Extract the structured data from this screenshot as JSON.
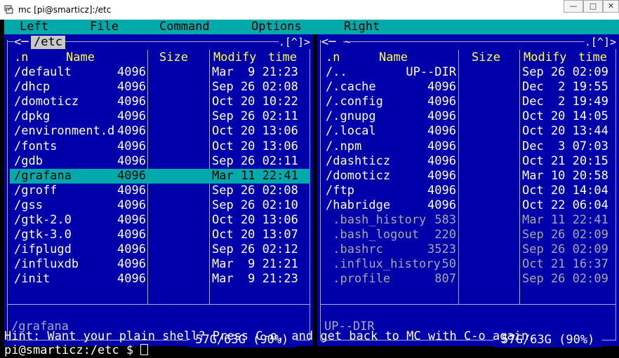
{
  "window": {
    "title": "mc [pi@smarticz]:/etc"
  },
  "menubar": {
    "items": [
      "Left",
      "File",
      "Command",
      "Options",
      "Right"
    ]
  },
  "left_panel": {
    "path": "/etc",
    "controls": ".[^]>",
    "columns": {
      "name_sort": ".n",
      "name": "Name",
      "size": "Size",
      "modify": "Modify",
      "time": "time"
    },
    "rows": [
      {
        "name": "/default",
        "size": "4096",
        "date": "Mar  9 21:23"
      },
      {
        "name": "/dhcp",
        "size": "4096",
        "date": "Sep 26 02:08"
      },
      {
        "name": "/domoticz",
        "size": "4096",
        "date": "Oct 20 10:22"
      },
      {
        "name": "/dpkg",
        "size": "4096",
        "date": "Sep 26 02:11"
      },
      {
        "name": "/environment.d",
        "size": "4096",
        "date": "Oct 20 13:06"
      },
      {
        "name": "/fonts",
        "size": "4096",
        "date": "Oct 20 13:06"
      },
      {
        "name": "/gdb",
        "size": "4096",
        "date": "Sep 26 02:11"
      },
      {
        "name": "/grafana",
        "size": "4096",
        "date": "Mar 11 22:41"
      },
      {
        "name": "/groff",
        "size": "4096",
        "date": "Sep 26 02:08"
      },
      {
        "name": "/gss",
        "size": "4096",
        "date": "Sep 26 02:10"
      },
      {
        "name": "/gtk-2.0",
        "size": "4096",
        "date": "Oct 20 13:06"
      },
      {
        "name": "/gtk-3.0",
        "size": "4096",
        "date": "Oct 20 13:07"
      },
      {
        "name": "/ifplugd",
        "size": "4096",
        "date": "Sep 26 02:12"
      },
      {
        "name": "/influxdb",
        "size": "4096",
        "date": "Mar  9 21:21"
      },
      {
        "name": "/init",
        "size": "4096",
        "date": "Mar  9 21:23"
      }
    ],
    "selected_index": 7,
    "status": "/grafana",
    "disk": " 57G/63G (90%) "
  },
  "right_panel": {
    "path": "~",
    "controls": ".[^]>",
    "columns": {
      "name_sort": ".n",
      "name": "Name",
      "size": "Size",
      "modify": "Modify",
      "time": "time"
    },
    "rows": [
      {
        "name": "/..",
        "size": "UP--DIR",
        "date": "Sep 26 02:09"
      },
      {
        "name": "/.cache",
        "size": "4096",
        "date": "Dec  2 19:55"
      },
      {
        "name": "/.config",
        "size": "4096",
        "date": "Dec  2 19:49"
      },
      {
        "name": "/.gnupg",
        "size": "4096",
        "date": "Oct 20 14:05"
      },
      {
        "name": "/.local",
        "size": "4096",
        "date": "Oct 20 13:44"
      },
      {
        "name": "/.npm",
        "size": "4096",
        "date": "Dec  3 07:03"
      },
      {
        "name": "/dashticz",
        "size": "4096",
        "date": "Oct 21 20:15"
      },
      {
        "name": "/domoticz",
        "size": "4096",
        "date": "Mar 10 20:58"
      },
      {
        "name": "/ftp",
        "size": "4096",
        "date": "Oct 20 14:04"
      },
      {
        "name": "/habridge",
        "size": "4096",
        "date": "Oct 22 06:04"
      },
      {
        "name": " .bash_history",
        "size": "583",
        "date": "Mar 11 22:41",
        "dim": true
      },
      {
        "name": " .bash_logout",
        "size": "220",
        "date": "Sep 26 02:09",
        "dim": true
      },
      {
        "name": " .bashrc",
        "size": "3523",
        "date": "Sep 26 02:09",
        "dim": true
      },
      {
        "name": " .influx_history",
        "size": "50",
        "date": "Oct 21 16:37",
        "dim": true
      },
      {
        "name": " .profile",
        "size": "807",
        "date": "Sep 26 02:09",
        "dim": true
      }
    ],
    "status": "UP--DIR",
    "disk": " 57G/63G (90%) "
  },
  "hint": "Hint: Want your plain shell? Press C-o, and get back to MC with C-o again.",
  "prompt": "pi@smarticz:/etc $ ",
  "colors": {
    "panel_bg": "#0000aa",
    "menubar_bg": "#00aaaa",
    "header_fg": "#ffff55",
    "selection_bg": "#00aaaa",
    "dim_fg": "#a8a8a8"
  }
}
